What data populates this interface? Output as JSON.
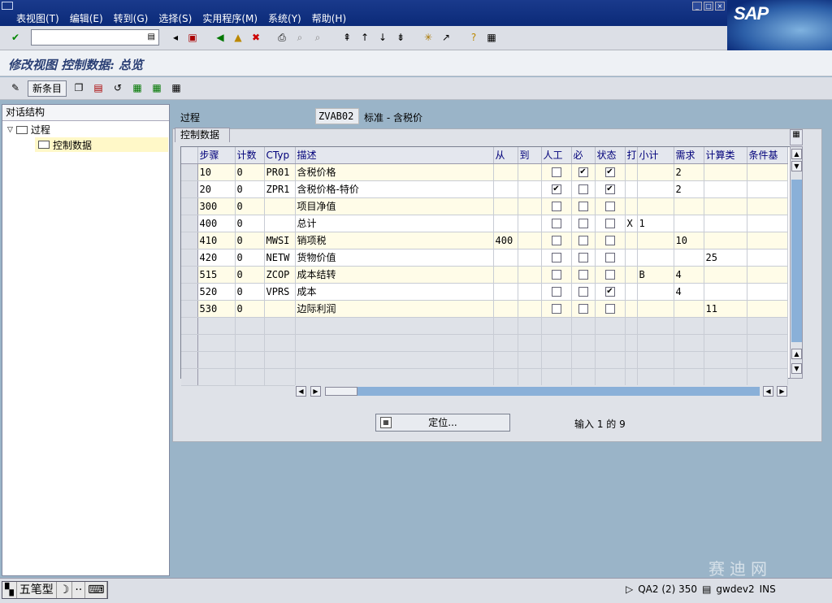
{
  "menu": {
    "items": [
      "表视图(T)",
      "编辑(E)",
      "转到(G)",
      "选择(S)",
      "实用程序(M)",
      "系统(Y)",
      "帮助(H)"
    ]
  },
  "brand": {
    "logo_text": "SAP"
  },
  "toolbar": {
    "command_value": "",
    "icons": [
      "check-icon",
      "save-icon",
      "back-icon",
      "exit-icon",
      "cancel-icon",
      "print-icon",
      "find-icon",
      "find-next-icon",
      "first-page-icon",
      "prev-page-icon",
      "next-page-icon",
      "last-page-icon",
      "new-session-icon",
      "shortcut-icon",
      "help-icon",
      "layout-icon"
    ]
  },
  "title": "修改视图 控制数据: 总览",
  "app_toolbar": {
    "new_entries_label": "新条目"
  },
  "tree": {
    "header": "对话结构",
    "node1": "过程",
    "node2": "控制数据"
  },
  "procedure": {
    "label": "过程",
    "value": "ZVAB02",
    "description": "标准 - 含税价"
  },
  "panel": {
    "tab_label": "控制数据"
  },
  "table": {
    "headers": [
      "步骤",
      "计数",
      "CTyp",
      "描述",
      "从",
      "到",
      "人工",
      "必",
      "状态",
      "打",
      "小计",
      "需求",
      "计算类",
      "条件基"
    ],
    "rows": [
      {
        "step": "10",
        "count": "0",
        "ctyp": "PR01",
        "desc": "含税价格",
        "from": "",
        "to": "",
        "manual": false,
        "required": true,
        "stat": true,
        "print": "",
        "subtotal": "",
        "req": "2",
        "calc": "",
        "base": ""
      },
      {
        "step": "20",
        "count": "0",
        "ctyp": "ZPR1",
        "desc": "含税价格-特价",
        "from": "",
        "to": "",
        "manual": true,
        "required": false,
        "stat": true,
        "print": "",
        "subtotal": "",
        "req": "2",
        "calc": "",
        "base": ""
      },
      {
        "step": "300",
        "count": "0",
        "ctyp": "",
        "desc": "项目净值",
        "from": "",
        "to": "",
        "manual": false,
        "required": false,
        "stat": false,
        "print": "",
        "subtotal": "",
        "req": "",
        "calc": "",
        "base": ""
      },
      {
        "step": "400",
        "count": "0",
        "ctyp": "",
        "desc": "总计",
        "from": "",
        "to": "",
        "manual": false,
        "required": false,
        "stat": false,
        "print": "X",
        "subtotal": "1",
        "req": "",
        "calc": "",
        "base": ""
      },
      {
        "step": "410",
        "count": "0",
        "ctyp": "MWSI",
        "desc": "销项税",
        "from": "400",
        "to": "",
        "manual": false,
        "required": false,
        "stat": false,
        "print": "",
        "subtotal": "",
        "req": "10",
        "calc": "",
        "base": ""
      },
      {
        "step": "420",
        "count": "0",
        "ctyp": "NETW",
        "desc": "货物价值",
        "from": "",
        "to": "",
        "manual": false,
        "required": false,
        "stat": false,
        "print": "",
        "subtotal": "",
        "req": "",
        "calc": "25",
        "base": ""
      },
      {
        "step": "515",
        "count": "0",
        "ctyp": "ZCOP",
        "desc": "成本结转",
        "from": "",
        "to": "",
        "manual": false,
        "required": false,
        "stat": false,
        "print": "",
        "subtotal": "B",
        "req": "4",
        "calc": "",
        "base": ""
      },
      {
        "step": "520",
        "count": "0",
        "ctyp": "VPRS",
        "desc": "成本",
        "from": "",
        "to": "",
        "manual": false,
        "required": false,
        "stat": true,
        "print": "",
        "subtotal": "",
        "req": "4",
        "calc": "",
        "base": ""
      },
      {
        "step": "530",
        "count": "0",
        "ctyp": "",
        "desc": "边际利润",
        "from": "",
        "to": "",
        "manual": false,
        "required": false,
        "stat": false,
        "print": "",
        "subtotal": "",
        "req": "",
        "calc": "11",
        "base": ""
      }
    ]
  },
  "position_button": {
    "label": "定位..."
  },
  "entry_info": "输入 1 的 9",
  "status": {
    "ime": [
      "五笔型"
    ],
    "system": "QA2 (2) 350",
    "server": "gwdev2",
    "mode": "INS"
  },
  "watermark": "赛迪网"
}
